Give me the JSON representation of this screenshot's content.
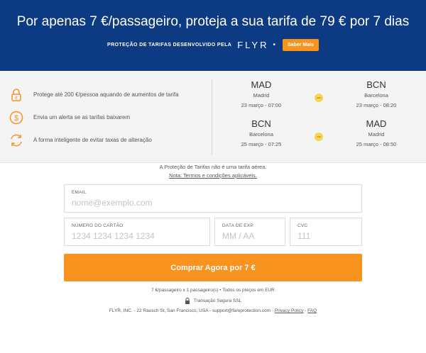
{
  "header": {
    "headline": "Por apenas 7 €/passageiro, proteja a sua tarifa de 79 € por 7 dias",
    "powered_by": "Proteção de tarifas desenvolvido pela",
    "brand": "FLYR",
    "separator": "•",
    "learn_more": "Saber Mais",
    "colors": {
      "background": "#0d3b83",
      "accent": "#f7931e"
    }
  },
  "features": [
    {
      "icon": "lock-icon",
      "text": "Protege até 200 €/pessoa aquando de aumentos de tarifa"
    },
    {
      "icon": "dollar-coin-icon",
      "text": "Envia um alerta se as tarifas baixarem"
    },
    {
      "icon": "refresh-icon",
      "text": "A forma inteligente de evitar taxas de alteração"
    }
  ],
  "flights": [
    {
      "origin": {
        "code": "MAD",
        "city": "Madrid",
        "datetime": "23 março - 07:00"
      },
      "destination": {
        "code": "BCN",
        "city": "Barcelona",
        "datetime": "23 março - 08:20"
      },
      "icon": "plane-icon"
    },
    {
      "origin": {
        "code": "BCN",
        "city": "Barcelona",
        "datetime": "25 março - 07:25"
      },
      "destination": {
        "code": "MAD",
        "city": "Madrid",
        "datetime": "25 março - 08:50"
      },
      "icon": "plane-icon"
    }
  ],
  "disclaimer": {
    "text": "A Proteção de Tarifas não é uma tarifa aérea.",
    "link": "Nota: Termos e condições aplicáveis."
  },
  "form": {
    "email": {
      "label": "EMAIL",
      "placeholder": "nome@exemplo.com",
      "value": ""
    },
    "card_number": {
      "label": "NÚMERO DO CARTÃO",
      "placeholder": "1234 1234 1234 1234",
      "value": ""
    },
    "expiry": {
      "label": "DATA DE EXP.",
      "placeholder": "MM / AA",
      "value": ""
    },
    "cvc": {
      "label": "CVC",
      "placeholder": "111",
      "value": ""
    },
    "submit": "Comprar Agora por 7 €"
  },
  "footer": {
    "summary": "7 €/passageiro x 1 passageiro(s) • Todos os preços em EUR",
    "secure": "Transação Segura SSL",
    "company": "FLYR, INC. - 22 Rausch St, San Francisco, USA - support@fareprotection.com -",
    "privacy": "Privacy Policy",
    "separator": "-",
    "faq": "FAQ"
  }
}
